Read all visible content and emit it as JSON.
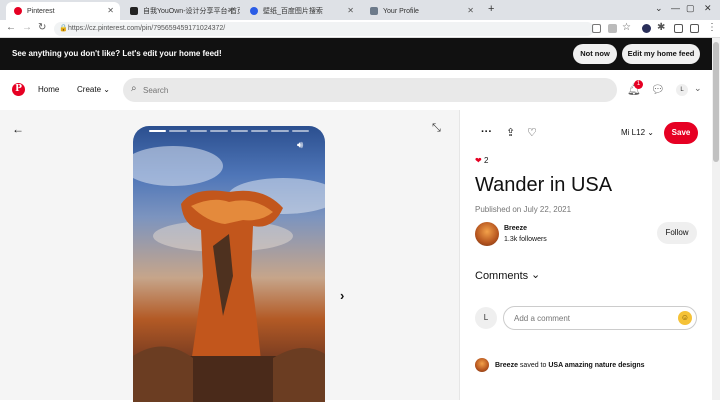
{
  "browser": {
    "tabs": [
      {
        "title": "Pinterest",
        "active": true,
        "color": "#e60023"
      },
      {
        "title": "自我YouOwn-设计分享平台-首页",
        "active": false,
        "color": "#222222"
      },
      {
        "title": "壁纸_百度图片搜索",
        "active": false,
        "color": "#2b5de6"
      },
      {
        "title": "Your Profile",
        "active": false,
        "color": "#6c7a8a"
      }
    ],
    "new_tab": "+",
    "url": "https://cz.pinterest.com/pin/795659459171024372/"
  },
  "banner": {
    "text": "See anything you don't like? Let's edit your home feed!",
    "not_now": "Not now",
    "edit_feed": "Edit my home feed"
  },
  "header": {
    "logo": "P",
    "home": "Home",
    "create": "Create",
    "search_placeholder": "Search",
    "notification_count": "1",
    "avatar_initial": "L"
  },
  "pin": {
    "board": "Mi L12",
    "save": "Save",
    "reaction_count": "2",
    "title": "Wander in USA",
    "published": "Published on July 22, 2021",
    "creator_name": "Breeze",
    "creator_followers": "1.3k followers",
    "follow": "Follow",
    "comments_heading": "Comments",
    "comment_avatar": "L",
    "comment_placeholder": "Add a comment",
    "saved_by": "Breeze",
    "saved_to_text": "saved to",
    "saved_board": "USA amazing nature designs"
  },
  "story": {
    "segments": 8,
    "active_segment": 1
  },
  "colors": {
    "brand": "#e60023",
    "banner_bg": "#111111",
    "search_bg": "#e9e9e9"
  }
}
